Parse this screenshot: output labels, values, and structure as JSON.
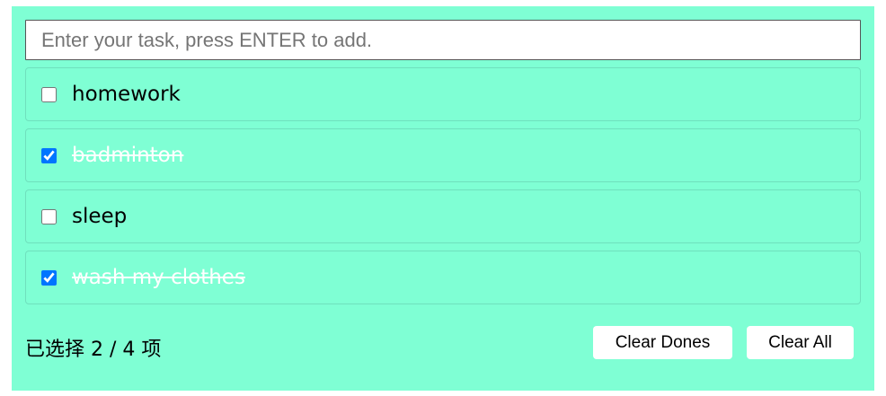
{
  "input": {
    "placeholder": "Enter your task, press ENTER to add.",
    "value": ""
  },
  "tasks": [
    {
      "label": "homework",
      "done": false
    },
    {
      "label": "badminton",
      "done": true
    },
    {
      "label": "sleep",
      "done": false
    },
    {
      "label": "wash my clothes",
      "done": true
    }
  ],
  "footer": {
    "summary": "已选择 2 / 4 项",
    "clear_dones_label": "Clear Dones",
    "clear_all_label": "Clear All"
  },
  "colors": {
    "background": "#7fffd4",
    "done_text": "#ffffff",
    "checkbox_accent": "#0075ff"
  }
}
